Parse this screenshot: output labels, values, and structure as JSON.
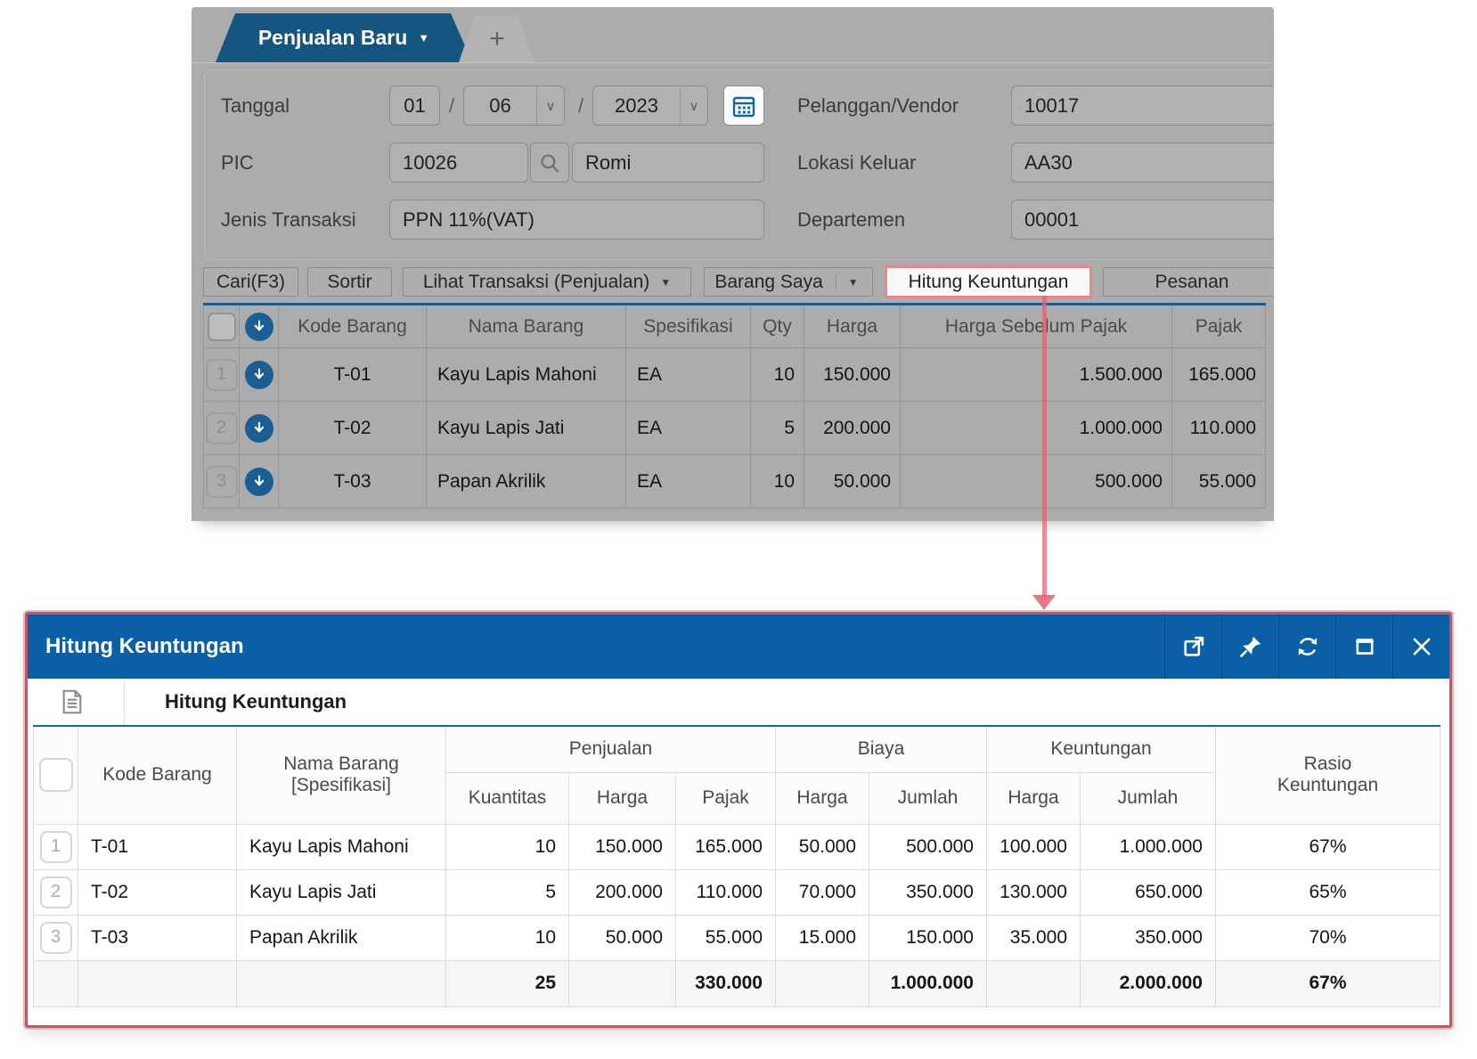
{
  "icons": {
    "caret_down": "▼",
    "chevron_down": "∨"
  },
  "colors": {
    "tab_blue": "#14567F",
    "modal_title_blue": "#0A5FA7",
    "grid_top_line_blue": "#1A5A8C",
    "highlight_pink_border": "#E8848E",
    "arrow_pink": "#E06270",
    "row_icon_circle_blue": "#1B5E94",
    "panel_gray": "#ACACAC"
  },
  "top_panel": {
    "active_tab": "Penjualan Baru",
    "add_tab": "+",
    "fields": {
      "tanggal": {
        "label": "Tanggal",
        "day": "01",
        "sep": "/",
        "month": "06",
        "year": "2023"
      },
      "pic": {
        "label": "PIC",
        "code": "10026",
        "name": "Romi"
      },
      "jenis": {
        "label": "Jenis Transaksi",
        "value": "PPN 11%(VAT)"
      },
      "pelanggan": {
        "label": "Pelanggan/Vendor",
        "value": "10017"
      },
      "lokasi": {
        "label": "Lokasi Keluar",
        "value": "AA30"
      },
      "departemen": {
        "label": "Departemen",
        "value": "00001"
      }
    },
    "toolbar": {
      "cari": "Cari(F3)",
      "sortir": "Sortir",
      "lihat": "Lihat Transaksi (Penjualan)",
      "barang": "Barang Saya",
      "hitung": "Hitung Keuntungan",
      "pesanan": "Pesanan"
    },
    "table": {
      "headers": [
        "Kode Barang",
        "Nama Barang",
        "Spesifikasi",
        "Qty",
        "Harga",
        "Harga Sebelum Pajak",
        "Pajak"
      ],
      "rows": [
        {
          "num": "1",
          "cells": [
            "T-01",
            "Kayu Lapis Mahoni",
            "EA",
            "10",
            "150.000",
            "1.500.000",
            "165.000"
          ]
        },
        {
          "num": "2",
          "cells": [
            "T-02",
            "Kayu Lapis Jati",
            "EA",
            "5",
            "200.000",
            "1.000.000",
            "110.000"
          ]
        },
        {
          "num": "3",
          "cells": [
            "T-03",
            "Papan Akrilik",
            "EA",
            "10",
            "50.000",
            "500.000",
            "55.000"
          ]
        }
      ]
    }
  },
  "modal": {
    "title": "Hitung Keuntungan",
    "subtitle": "Hitung Keuntungan",
    "window_icons": [
      "open-in-new-window",
      "pin",
      "refresh",
      "maximize",
      "close"
    ],
    "table": {
      "col_headers": {
        "kode": "Kode Barang",
        "nama": [
          "Nama Barang",
          "[Spesifikasi]"
        ],
        "rasio": [
          "Rasio",
          "Keuntungan"
        ]
      },
      "groups": [
        {
          "label": "Penjualan",
          "cols": [
            "Kuantitas",
            "Harga",
            "Pajak"
          ]
        },
        {
          "label": "Biaya",
          "cols": [
            "Harga",
            "Jumlah"
          ]
        },
        {
          "label": "Keuntungan",
          "cols": [
            "Harga",
            "Jumlah"
          ]
        }
      ],
      "rows": [
        {
          "num": "1",
          "cells": [
            "T-01",
            "Kayu Lapis Mahoni",
            "10",
            "150.000",
            "165.000",
            "50.000",
            "500.000",
            "100.000",
            "1.000.000",
            "67%"
          ]
        },
        {
          "num": "2",
          "cells": [
            "T-02",
            "Kayu Lapis Jati",
            "5",
            "200.000",
            "110.000",
            "70.000",
            "350.000",
            "130.000",
            "650.000",
            "65%"
          ]
        },
        {
          "num": "3",
          "cells": [
            "T-03",
            "Papan Akrilik",
            "10",
            "50.000",
            "55.000",
            "15.000",
            "150.000",
            "35.000",
            "350.000",
            "70%"
          ]
        }
      ],
      "totals": [
        "",
        "",
        "25",
        "",
        "330.000",
        "",
        "1.000.000",
        "",
        "2.000.000",
        "67%"
      ]
    }
  }
}
